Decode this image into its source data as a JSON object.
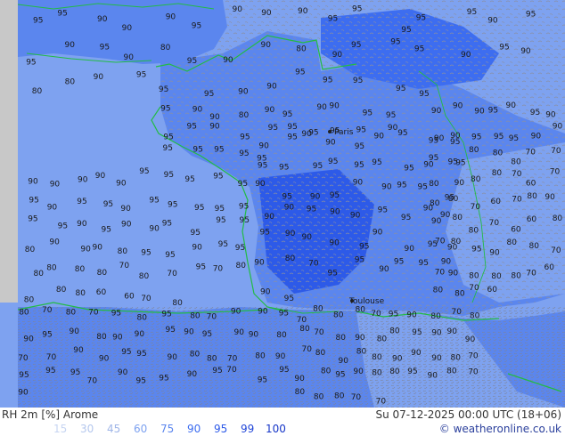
{
  "footer": {
    "title": "RH 2m [%] Arome",
    "time": "Su 07-12-2025 00:00 UTC (18+06)",
    "credit": "© weatheronline.co.uk"
  },
  "legend": [
    {
      "label": "15",
      "color": "#c7d5f2"
    },
    {
      "label": "30",
      "color": "#b5c8ee"
    },
    {
      "label": "45",
      "color": "#9fb6e8"
    },
    {
      "label": "60",
      "color": "#7ea2f0"
    },
    {
      "label": "75",
      "color": "#5b86ee"
    },
    {
      "label": "90",
      "color": "#3d6df0"
    },
    {
      "label": "95",
      "color": "#2d5ae8"
    },
    {
      "label": "99",
      "color": "#2247d8"
    },
    {
      "label": "100",
      "color": "#1636c8"
    }
  ],
  "cities": [
    "Paris",
    "Toulouse"
  ],
  "map_labels": {
    "north_coast": [
      "95",
      "95",
      "90",
      "90",
      "90",
      "95",
      "90",
      "90",
      "90",
      "95",
      "95",
      "95",
      "95",
      "95",
      "90",
      "95",
      "95",
      "90",
      "95",
      "90",
      "80",
      "95",
      "90",
      "90",
      "80",
      "90",
      "95",
      "95",
      "95",
      "90",
      "95",
      "90",
      "80",
      "80",
      "90",
      "95",
      "95",
      "95",
      "90",
      "90",
      "95",
      "95",
      "95",
      "95",
      "95"
    ],
    "north_central": [
      "95",
      "90",
      "90",
      "80",
      "90",
      "95",
      "90",
      "90",
      "95",
      "95",
      "95",
      "95",
      "90",
      "95",
      "95",
      "95",
      "95",
      "95",
      "95",
      "90",
      "95",
      "95",
      "95",
      "95",
      "95"
    ],
    "west": [
      "90",
      "90",
      "90",
      "90",
      "90",
      "95",
      "95",
      "95",
      "95",
      "95",
      "95",
      "90",
      "95",
      "95",
      "90",
      "95",
      "95",
      "95",
      "95",
      "95",
      "95",
      "95",
      "90",
      "95",
      "90",
      "90",
      "95",
      "95",
      "95",
      "95",
      "80",
      "90",
      "90",
      "90",
      "80",
      "95",
      "95",
      "90",
      "95",
      "95",
      "80",
      "80",
      "80",
      "80",
      "70",
      "80",
      "70",
      "95",
      "70",
      "80",
      "80",
      "80",
      "80",
      "60",
      "60",
      "70",
      "80"
    ],
    "central": [
      "90",
      "95",
      "90",
      "90",
      "95",
      "90",
      "95",
      "95",
      "95",
      "95",
      "95",
      "95",
      "95",
      "95",
      "95",
      "95",
      "90",
      "95",
      "90",
      "95",
      "90",
      "95",
      "90",
      "90",
      "95",
      "95",
      "95",
      "90",
      "90",
      "95",
      "90",
      "90",
      "95",
      "95",
      "90",
      "90",
      "95",
      "90",
      "90",
      "90",
      "95",
      "90",
      "90",
      "95",
      "90",
      "90",
      "80",
      "70",
      "95",
      "95",
      "90",
      "95",
      "95",
      "90",
      "90",
      "95"
    ],
    "south_west": [
      "80",
      "70",
      "80",
      "70",
      "95",
      "80",
      "95",
      "80",
      "70",
      "90",
      "90",
      "95",
      "90",
      "95",
      "90",
      "80",
      "90",
      "90",
      "95",
      "90",
      "95",
      "90",
      "90",
      "80",
      "70",
      "70",
      "90",
      "90",
      "95",
      "95",
      "90",
      "80",
      "80",
      "70",
      "80",
      "90",
      "95",
      "95",
      "95",
      "70",
      "90",
      "95",
      "95",
      "90",
      "95",
      "70",
      "95",
      "95",
      "90"
    ],
    "south": [
      "70",
      "80",
      "80",
      "80",
      "70",
      "95",
      "90",
      "80",
      "70",
      "80",
      "80",
      "70",
      "80",
      "90",
      "80",
      "80",
      "95",
      "90",
      "90",
      "90",
      "70",
      "80",
      "90",
      "80",
      "80",
      "90",
      "90",
      "90",
      "80",
      "70",
      "90",
      "80",
      "95",
      "90",
      "80",
      "80",
      "95",
      "90",
      "80",
      "70",
      "80",
      "80",
      "80",
      "70",
      "70"
    ],
    "east": [
      "90",
      "90",
      "90",
      "95",
      "90",
      "95",
      "90",
      "90",
      "90",
      "95",
      "95",
      "95",
      "90",
      "90",
      "95",
      "95",
      "80",
      "80",
      "80",
      "70",
      "70",
      "80",
      "90",
      "80",
      "80",
      "70",
      "60",
      "70",
      "80",
      "80",
      "70",
      "60",
      "70",
      "80",
      "90",
      "90",
      "80",
      "80",
      "70",
      "60",
      "60",
      "80",
      "70",
      "80",
      "95",
      "90",
      "80",
      "80",
      "70",
      "70",
      "90",
      "80",
      "80",
      "80",
      "70",
      "60",
      "80",
      "80",
      "70",
      "60"
    ]
  }
}
